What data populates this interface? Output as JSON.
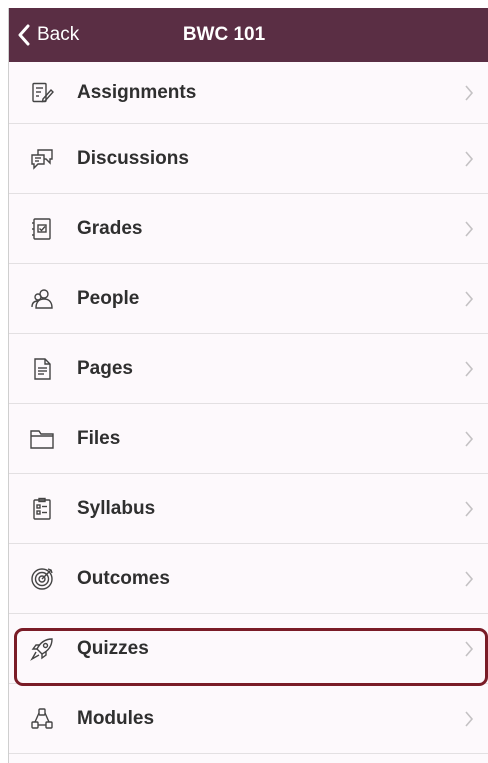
{
  "navbar": {
    "back_label": "Back",
    "title": "BWC 101"
  },
  "menu": [
    {
      "label": "Assignments",
      "icon": "assignments-icon"
    },
    {
      "label": "Discussions",
      "icon": "discussions-icon"
    },
    {
      "label": "Grades",
      "icon": "grades-icon"
    },
    {
      "label": "People",
      "icon": "people-icon"
    },
    {
      "label": "Pages",
      "icon": "pages-icon"
    },
    {
      "label": "Files",
      "icon": "folder-icon"
    },
    {
      "label": "Syllabus",
      "icon": "syllabus-icon"
    },
    {
      "label": "Outcomes",
      "icon": "outcomes-icon"
    },
    {
      "label": "Quizzes",
      "icon": "rocket-icon",
      "highlighted": true
    },
    {
      "label": "Modules",
      "icon": "modules-icon"
    }
  ],
  "colors": {
    "navbar": "#5a2e44",
    "highlight": "#7a1c27",
    "background": "#fdf9fc"
  }
}
